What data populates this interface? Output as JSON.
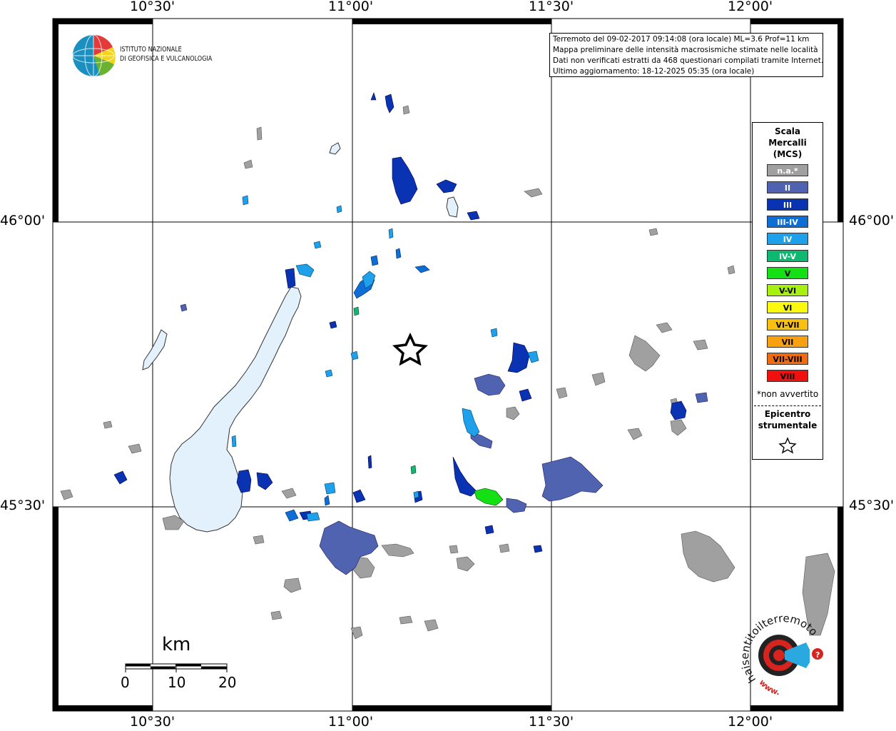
{
  "map": {
    "lon_labels_top": [
      "10°30'",
      "11°00'",
      "11°30'",
      "12°00'"
    ],
    "lon_labels_bottom": [
      "10°30'",
      "11°00'",
      "11°30'",
      "12°00'"
    ],
    "lat_labels_left": [
      "46°00'",
      "45°30'"
    ],
    "lat_labels_right": [
      "46°00'",
      "45°30'"
    ]
  },
  "institute": {
    "line1": "ISTITUTO NAZIONALE",
    "line2": "DI GEOFISICA E VULCANOLOGIA",
    "logo": "ingv-globe-logo"
  },
  "info": {
    "line1": "Terremoto del 09-02-2017 09:14:08 (ora locale) ML=3.6 Prof=11 km",
    "line2": "Mappa preliminare delle intensità macrosismiche stimate nelle località",
    "line3": "Dati non verificati estratti da 468 questionari compilati tramite Internet.",
    "line4": "Ultimo aggiornamento: 18-12-2025 05:35 (ora locale)"
  },
  "legend": {
    "title1": "Scala",
    "title2": "Mercalli",
    "title3": "(MCS)",
    "items": [
      {
        "label": "n.a.*",
        "color": "#a0a0a0"
      },
      {
        "label": "II",
        "color": "#5063b0"
      },
      {
        "label": "III",
        "color": "#0a33b4"
      },
      {
        "label": "III-IV",
        "color": "#0d6fd6"
      },
      {
        "label": "IV",
        "color": "#1ea0ea"
      },
      {
        "label": "IV-V",
        "color": "#0fb870"
      },
      {
        "label": "V",
        "color": "#14e014"
      },
      {
        "label": "V-VI",
        "color": "#a8f010"
      },
      {
        "label": "VI",
        "color": "#fafa10"
      },
      {
        "label": "VI-VII",
        "color": "#f8c010"
      },
      {
        "label": "VII",
        "color": "#f8a010"
      },
      {
        "label": "VII-VIII",
        "color": "#f06a10"
      },
      {
        "label": "VIII",
        "color": "#f01010"
      }
    ],
    "note": "*non avvertito",
    "epicenter1": "Epicentro",
    "epicenter2": "strumentale",
    "star_icon": "star-outline-icon"
  },
  "scale": {
    "unit": "km",
    "ticks": [
      "0",
      "10",
      "20"
    ]
  },
  "haisentito": {
    "text": "haisentitoilterremoto.it",
    "url": "www.",
    "logo": "haisentito-logo"
  },
  "colors": {
    "lake": "#e2f1fb",
    "not_felt": "#a0a0a0",
    "II": "#5063b0",
    "III": "#0a33b4",
    "III-IV": "#0d6fd6",
    "IV": "#1ea0ea",
    "IV-V": "#0fb870",
    "V": "#14e014"
  }
}
